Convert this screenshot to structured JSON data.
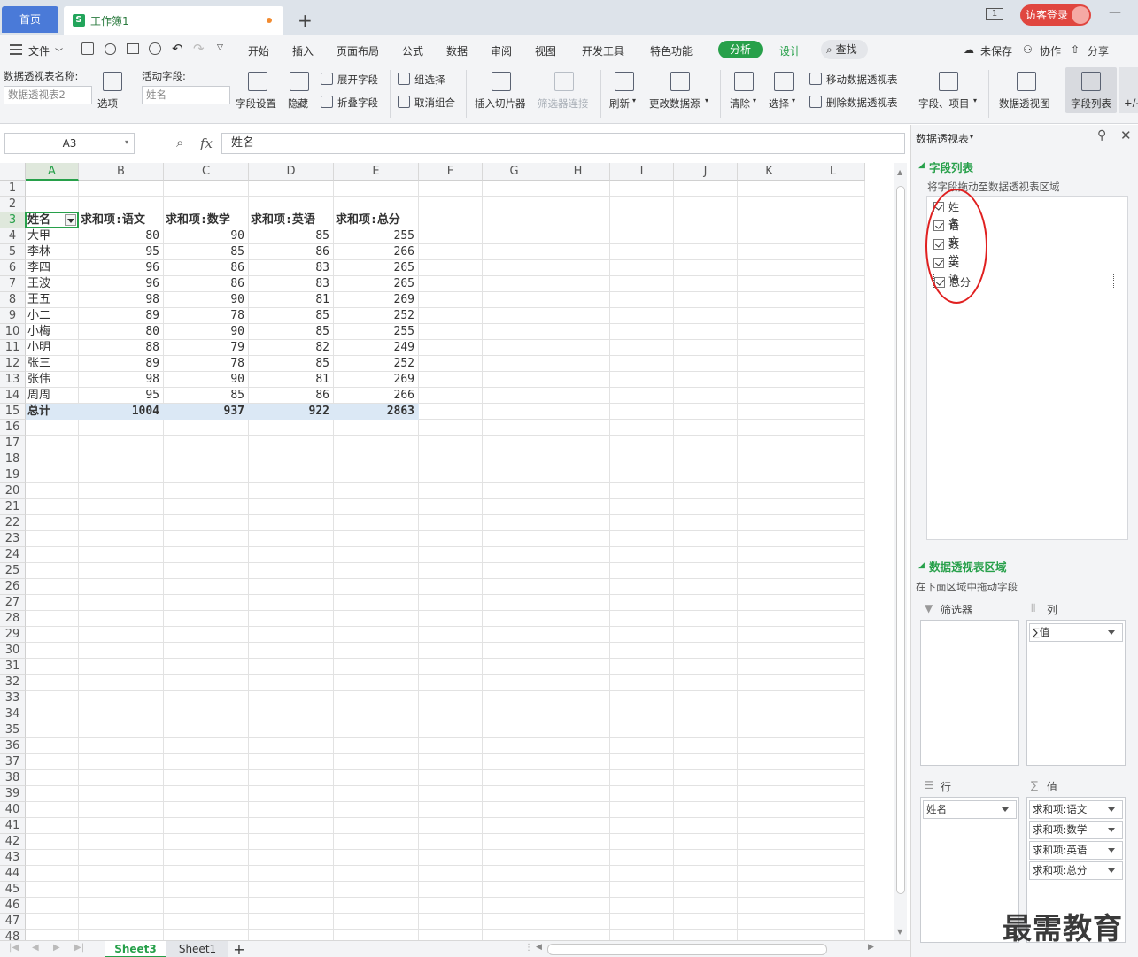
{
  "titlebar": {
    "home_tab": "首页",
    "doc_tab": "工作簿1",
    "login": "访客登录"
  },
  "menubar": {
    "file": "文件",
    "items": [
      "开始",
      "插入",
      "页面布局",
      "公式",
      "数据",
      "审阅",
      "视图",
      "开发工具",
      "特色功能",
      "分析",
      "设计"
    ],
    "search": "查找",
    "unsaved": "未保存",
    "collab": "协作",
    "share": "分享"
  },
  "ribbon": {
    "pt_name_label": "数据透视表名称:",
    "pt_name_value": "数据透视表2",
    "options": "选项",
    "active_field_label": "活动字段:",
    "active_field_value": "姓名",
    "field_settings": "字段设置",
    "hide": "隐藏",
    "expand_field": "展开字段",
    "collapse_field": "折叠字段",
    "group_select": "组选择",
    "ungroup": "取消组合",
    "insert_slicer": "插入切片器",
    "filter_conn": "筛选器连接",
    "refresh": "刷新",
    "change_source": "更改数据源",
    "clear": "清除",
    "select": "选择",
    "move_pt": "移动数据透视表",
    "delete_pt": "删除数据透视表",
    "fields_items": "字段、项目",
    "pivot_chart": "数据透视图",
    "field_list": "字段列表",
    "plus_minus": "+/-"
  },
  "formula": {
    "cell_ref": "A3",
    "fx": "fx",
    "value": "姓名"
  },
  "columns": [
    "A",
    "B",
    "C",
    "D",
    "E",
    "F",
    "G",
    "H",
    "I",
    "J",
    "K",
    "L"
  ],
  "rows_count": 48,
  "table": {
    "headers": [
      "姓名",
      "求和项:语文",
      "求和项:数学",
      "求和项:英语",
      "求和项:总分"
    ],
    "rows": [
      [
        "大甲",
        "80",
        "90",
        "85",
        "255"
      ],
      [
        "李林",
        "95",
        "85",
        "86",
        "266"
      ],
      [
        "李四",
        "96",
        "86",
        "83",
        "265"
      ],
      [
        "王波",
        "96",
        "86",
        "83",
        "265"
      ],
      [
        "王五",
        "98",
        "90",
        "81",
        "269"
      ],
      [
        "小二",
        "89",
        "78",
        "85",
        "252"
      ],
      [
        "小梅",
        "80",
        "90",
        "85",
        "255"
      ],
      [
        "小明",
        "88",
        "79",
        "82",
        "249"
      ],
      [
        "张三",
        "89",
        "78",
        "85",
        "252"
      ],
      [
        "张伟",
        "98",
        "90",
        "81",
        "269"
      ],
      [
        "周周",
        "95",
        "85",
        "86",
        "266"
      ]
    ],
    "total": [
      "总计",
      "1004",
      "937",
      "922",
      "2863"
    ]
  },
  "sheets": {
    "active": "Sheet3",
    "other": "Sheet1",
    "add": "+"
  },
  "pane": {
    "title": "数据透视表",
    "field_list_title": "字段列表",
    "drag_hint": "将字段拖动至数据透视表区域",
    "fields": [
      "姓名",
      "语文",
      "数学",
      "英语",
      "总分"
    ],
    "areas_title": "数据透视表区域",
    "areas_hint": "在下面区域中拖动字段",
    "filter_label": "筛选器",
    "col_label": "列",
    "row_label": "行",
    "val_label": "值",
    "col_items": [
      "∑值"
    ],
    "row_items": [
      "姓名"
    ],
    "val_items": [
      "求和项:语文",
      "求和项:数学",
      "求和项:英语",
      "求和项:总分"
    ]
  },
  "watermark": "最需教育",
  "colors": {
    "accent": "#27a04a",
    "home_tab": "#4a7ad8",
    "login": "#e0463f",
    "total_bg": "#dbe8f5",
    "annotation": "#e02020"
  }
}
